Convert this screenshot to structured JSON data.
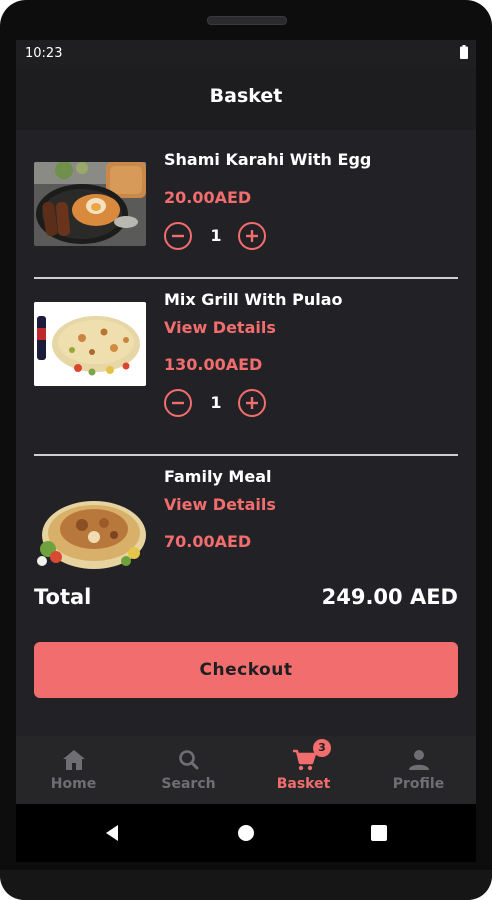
{
  "status": {
    "time": "10:23"
  },
  "appbar": {
    "title": "Basket"
  },
  "items": [
    {
      "name": "Shami Karahi With Egg",
      "details": "",
      "price": "20.00AED",
      "qty": "1"
    },
    {
      "name": "Mix Grill With Pulao",
      "details": "View Details",
      "price": "130.00AED",
      "qty": "1"
    },
    {
      "name": "Family Meal",
      "details": "View Details",
      "price": "70.00AED"
    }
  ],
  "total": {
    "label": "Total",
    "value": "249.00 AED"
  },
  "checkout_label": "Checkout",
  "tabs": [
    {
      "label": "Home",
      "icon": "home-icon",
      "active": false
    },
    {
      "label": "Search",
      "icon": "search-icon",
      "active": false
    },
    {
      "label": "Basket",
      "icon": "cart-icon",
      "active": true,
      "badge": "3"
    },
    {
      "label": "Profile",
      "icon": "person-icon",
      "active": false
    }
  ],
  "colors": {
    "accent": "#f26d6d",
    "background": "#1f1f22",
    "inactive": "#6f6f73"
  }
}
